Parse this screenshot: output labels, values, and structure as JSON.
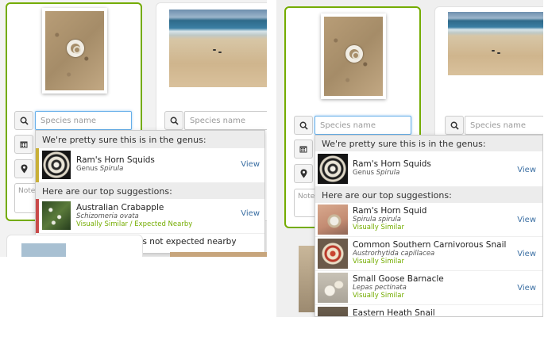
{
  "colors": {
    "accent_green": "#74ac00",
    "link_blue": "#3b6fa3",
    "genus_bar": "#c9b037",
    "crabapple_bar": "#c94a4a"
  },
  "left": {
    "search": {
      "placeholder": "Species name",
      "value": ""
    },
    "search2": {
      "placeholder": "Species name"
    },
    "notes": {
      "placeholder": "Note"
    },
    "dropdown": {
      "genus_header": "We're pretty sure this is in the genus:",
      "genus": {
        "name": "Ram's Horn Squids",
        "rank_label": "Genus",
        "sci": "Spirula",
        "view": "View",
        "icon": "ammonite-photo"
      },
      "suggest_header": "Here are our top suggestions:",
      "suggestions": [
        {
          "name": "Australian Crabapple",
          "sci": "Schizomeria ovata",
          "tag": "Visually Similar / Expected Nearby",
          "view": "View",
          "icon": "crabapple-photo"
        }
      ],
      "footer": "Include suggestions not expected nearby"
    }
  },
  "right": {
    "search": {
      "placeholder": "Species name",
      "value": ""
    },
    "search2": {
      "placeholder": "Species name"
    },
    "notes": {
      "placeholder": "Note"
    },
    "dropdown": {
      "genus_header": "We're pretty sure this is in the genus:",
      "genus": {
        "name": "Ram's Horn Squids",
        "rank_label": "Genus",
        "sci": "Spirula",
        "view": "View",
        "icon": "ammonite-photo"
      },
      "suggest_header": "Here are our top suggestions:",
      "suggestions": [
        {
          "name": "Ram's Horn Squid",
          "sci": "Spirula spirula",
          "tag": "Visually Similar",
          "view": "View",
          "icon": "hand-shell-photo"
        },
        {
          "name": "Common Southern Carnivorous Snail",
          "sci": "Austrorhytida capillacea",
          "tag": "Visually Similar",
          "view": "View",
          "icon": "snail-photo"
        },
        {
          "name": "Small Goose Barnacle",
          "sci": "Lepas pectinata",
          "tag": "Visually Similar",
          "view": "View",
          "icon": "barnacle-photo"
        },
        {
          "name": "Eastern Heath Snail",
          "sci": "",
          "tag": "",
          "view": "",
          "icon": "heath-snail-photo"
        }
      ]
    }
  },
  "icons": {
    "search": "search-icon",
    "calendar": "calendar-icon",
    "location": "location-pin-icon"
  }
}
